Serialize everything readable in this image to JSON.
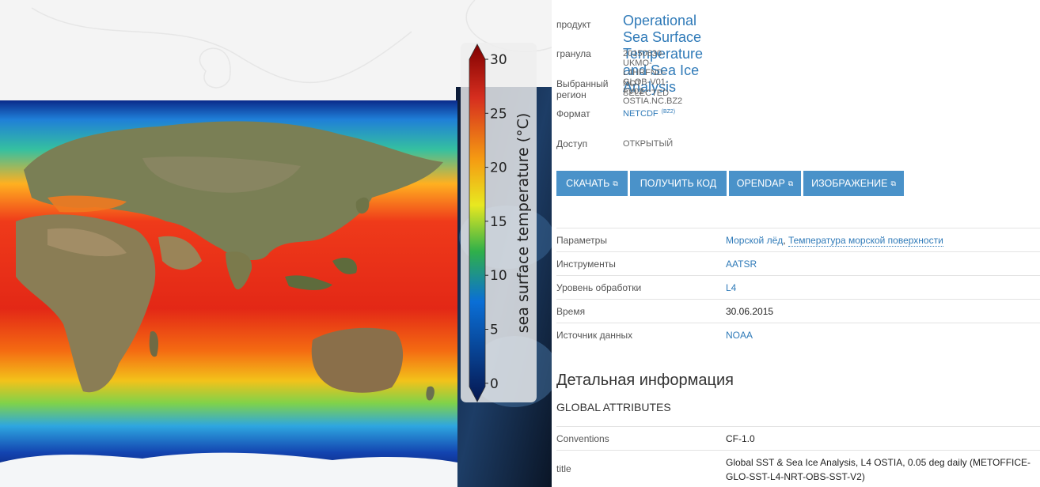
{
  "colorbar": {
    "ticks": [
      "30",
      "25",
      "20",
      "15",
      "10",
      "5",
      "0"
    ],
    "label": "sea surface temperature (°C)",
    "colors": [
      "#7f0000",
      "#d62e1f",
      "#f59a12",
      "#e8e820",
      "#2fb04a",
      "#0a6fd6",
      "#06164f"
    ]
  },
  "info": {
    "product": {
      "label": "продукт",
      "value": "Operational Sea Surface Temperature and Sea Ice Analysis"
    },
    "granule": {
      "label": "гранула",
      "value": "20150630-UKMO-L4HRFND-GLOB-V01-FV02-OSTIA.NC.BZ2"
    },
    "region": {
      "label": "Выбранный регион",
      "value": "NOT SELECTED"
    },
    "format": {
      "label": "Формат",
      "value": "NETCDF",
      "sup": "(BZ2)"
    },
    "access": {
      "label": "Доступ",
      "value": "ОТКРЫТЫЙ"
    }
  },
  "buttons": {
    "download": "СКАЧАТЬ",
    "get_code": "ПОЛУЧИТЬ КОД",
    "opendap": "OPENDAP",
    "image": "ИЗОБРАЖЕНИЕ"
  },
  "params": {
    "parameters_label": "Параметры",
    "param1": "Морской лёд",
    "param_sep": ",",
    "param2": "Температура морской поверхности",
    "instruments_label": "Инструменты",
    "instruments_value": "AATSR",
    "level_label": "Уровень обработки",
    "level_value": "L4",
    "time_label": "Время",
    "time_value": "30.06.2015",
    "source_label": "Источник данных",
    "source_value": "NOAA"
  },
  "details": {
    "title": "Детальная информация",
    "global_attributes": "GLOBAL ATTRIBUTES",
    "conventions_label": "Conventions",
    "conventions_value": "CF-1.0",
    "title_label": "title",
    "title_value": "Global SST & Sea Ice Analysis, L4 OSTIA, 0.05 deg daily (METOFFICE-GLO-SST-L4-NRT-OBS-SST-V2)"
  }
}
